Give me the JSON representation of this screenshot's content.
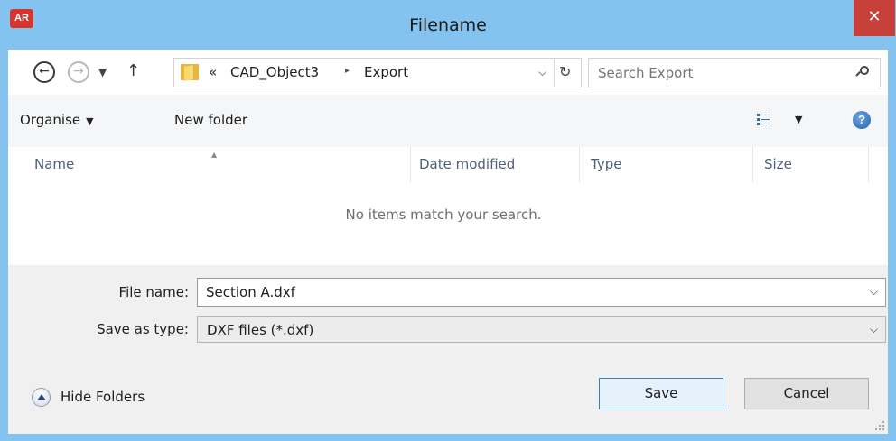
{
  "window": {
    "title": "Filename",
    "app_icon_text": "AR",
    "close_glyph": "✕"
  },
  "nav": {
    "breadcrumb_prefix": "«",
    "breadcrumb": [
      "CAD_Object3",
      "Export"
    ],
    "breadcrumb_separator": "▸",
    "search_placeholder": "Search Export"
  },
  "toolbar": {
    "organise_label": "Organise",
    "new_folder_label": "New folder"
  },
  "file_list": {
    "columns": [
      "Name",
      "Date modified",
      "Type",
      "Size"
    ],
    "empty_message": "No items match your search."
  },
  "form": {
    "file_name_label": "File name:",
    "file_name_value": "Section A.dxf",
    "save_type_label": "Save as type:",
    "save_type_value": "DXF files (*.dxf)"
  },
  "footer": {
    "hide_folders_label": "Hide Folders",
    "save_label": "Save",
    "cancel_label": "Cancel"
  },
  "colors": {
    "frame": "#84c2ef",
    "close_button": "#c7403a",
    "save_button_border": "#3c7fb1"
  }
}
